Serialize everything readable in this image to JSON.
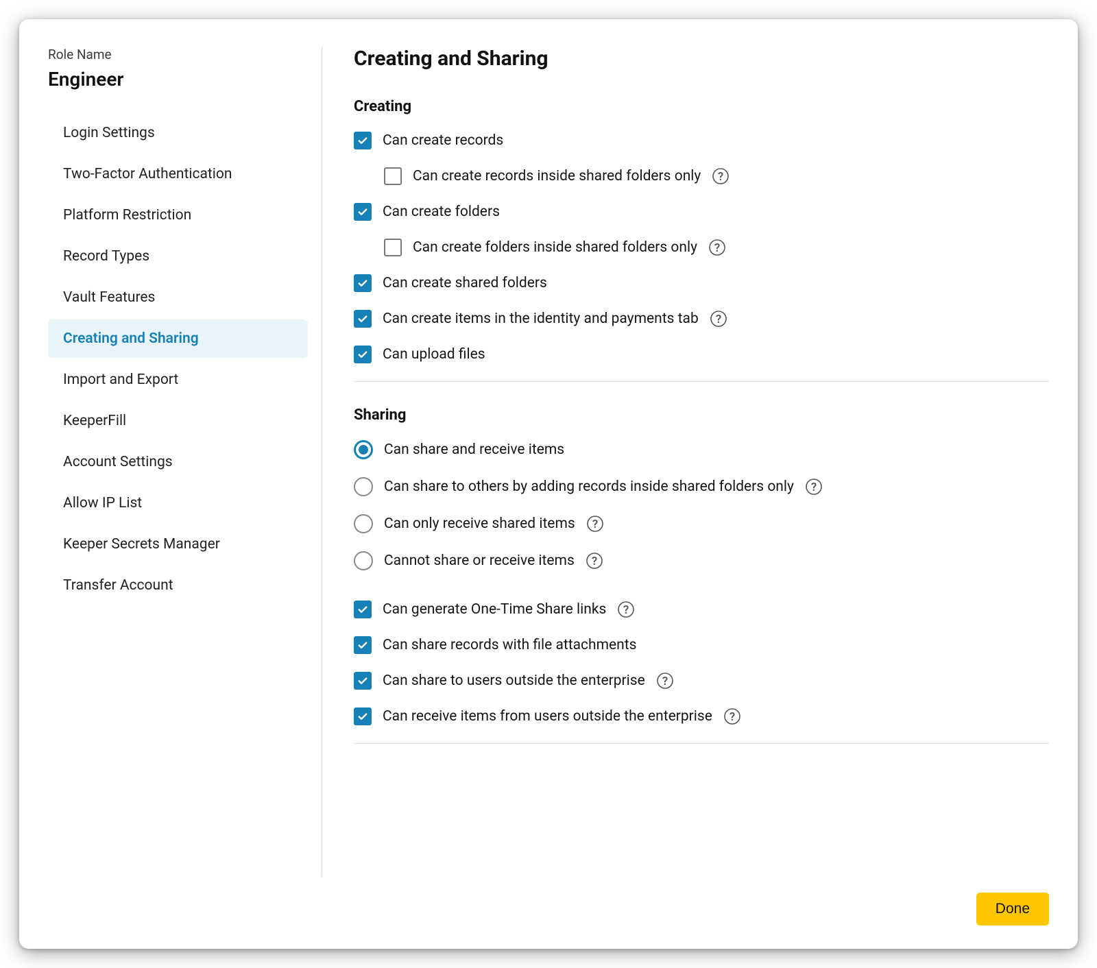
{
  "sidebar": {
    "role_name_label": "Role Name",
    "role_name": "Engineer",
    "items": [
      {
        "label": "Login Settings",
        "active": false
      },
      {
        "label": "Two-Factor Authentication",
        "active": false
      },
      {
        "label": "Platform Restriction",
        "active": false
      },
      {
        "label": "Record Types",
        "active": false
      },
      {
        "label": "Vault Features",
        "active": false
      },
      {
        "label": "Creating and Sharing",
        "active": true
      },
      {
        "label": "Import and Export",
        "active": false
      },
      {
        "label": "KeeperFill",
        "active": false
      },
      {
        "label": "Account Settings",
        "active": false
      },
      {
        "label": "Allow IP List",
        "active": false
      },
      {
        "label": "Keeper Secrets Manager",
        "active": false
      },
      {
        "label": "Transfer Account",
        "active": false
      }
    ]
  },
  "main": {
    "title": "Creating and Sharing",
    "sections": {
      "creating": {
        "title": "Creating",
        "options": [
          {
            "type": "checkbox",
            "checked": true,
            "indent": false,
            "label": "Can create records",
            "help": false
          },
          {
            "type": "checkbox",
            "checked": false,
            "indent": true,
            "label": "Can create records inside shared folders only",
            "help": true
          },
          {
            "type": "checkbox",
            "checked": true,
            "indent": false,
            "label": "Can create folders",
            "help": false
          },
          {
            "type": "checkbox",
            "checked": false,
            "indent": true,
            "label": "Can create folders inside shared folders only",
            "help": true
          },
          {
            "type": "checkbox",
            "checked": true,
            "indent": false,
            "label": "Can create shared folders",
            "help": false
          },
          {
            "type": "checkbox",
            "checked": true,
            "indent": false,
            "label": "Can create items in the identity and payments tab",
            "help": true
          },
          {
            "type": "checkbox",
            "checked": true,
            "indent": false,
            "label": "Can upload files",
            "help": false
          }
        ]
      },
      "sharing": {
        "title": "Sharing",
        "radios": [
          {
            "selected": true,
            "label": "Can share and receive items",
            "help": false
          },
          {
            "selected": false,
            "label": "Can share to others by adding records inside shared folders only",
            "help": true
          },
          {
            "selected": false,
            "label": "Can only receive shared items",
            "help": true
          },
          {
            "selected": false,
            "label": "Cannot share or receive items",
            "help": true
          }
        ],
        "checkboxes": [
          {
            "checked": true,
            "label": "Can generate One-Time Share links",
            "help": true
          },
          {
            "checked": true,
            "label": "Can share records with file attachments",
            "help": false
          },
          {
            "checked": true,
            "label": "Can share to users outside the enterprise",
            "help": true
          },
          {
            "checked": true,
            "label": "Can receive items from users outside the enterprise",
            "help": true
          }
        ]
      }
    }
  },
  "footer": {
    "done_label": "Done"
  },
  "colors": {
    "accent": "#1581b6",
    "button": "#ffc700",
    "nav_active_bg": "#e9f4f8"
  }
}
